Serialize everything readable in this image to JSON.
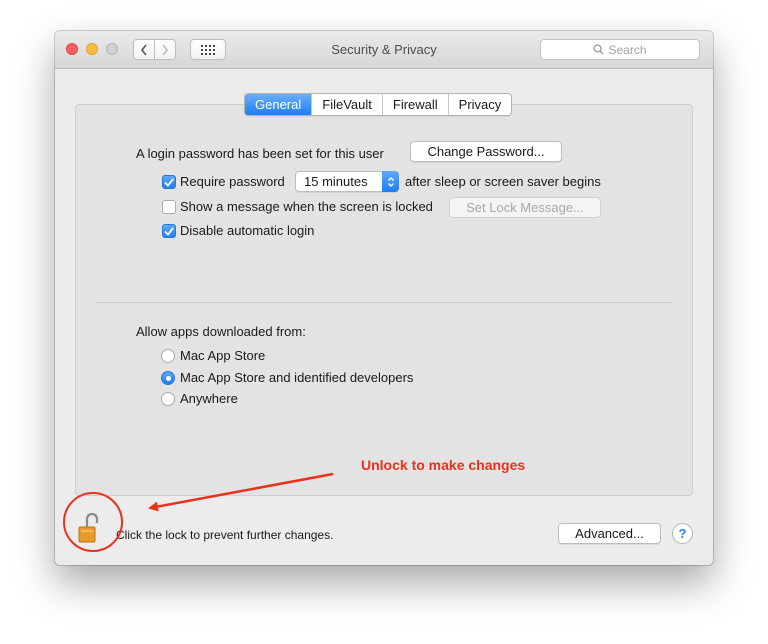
{
  "window": {
    "title": "Security & Privacy"
  },
  "toolbar": {
    "search_placeholder": "Search"
  },
  "tabs": [
    {
      "label": "General",
      "active": true
    },
    {
      "label": "FileVault",
      "active": false
    },
    {
      "label": "Firewall",
      "active": false
    },
    {
      "label": "Privacy",
      "active": false
    }
  ],
  "general": {
    "login_text": "A login password has been set for this user",
    "change_password_label": "Change Password...",
    "require_password": {
      "label": "Require password",
      "checked": true,
      "interval": "15 minutes",
      "suffix": "after sleep or screen saver begins"
    },
    "show_message": {
      "label": "Show a message when the screen is locked",
      "checked": false,
      "button_label": "Set Lock Message..."
    },
    "disable_autologin": {
      "label": "Disable automatic login",
      "checked": true
    },
    "allow_apps_label": "Allow apps downloaded from:",
    "allow_options": [
      {
        "label": "Mac App Store",
        "selected": false
      },
      {
        "label": "Mac App Store and identified developers",
        "selected": true
      },
      {
        "label": "Anywhere",
        "selected": false
      }
    ]
  },
  "footer": {
    "lock_text": "Click the lock to prevent further changes.",
    "advanced_label": "Advanced...",
    "help_label": "?"
  },
  "annotation": {
    "text": "Unlock to make changes",
    "color": "#e8321b"
  },
  "colors": {
    "accent": "#1d7ef2",
    "annotation": "#e8321b",
    "lock_body": "#e59a2a"
  },
  "icons": [
    "back-chevron-icon",
    "forward-chevron-icon",
    "grid-icon",
    "search-icon",
    "checkmark-icon",
    "popup-arrows-icon",
    "lock-open-icon",
    "help-icon"
  ]
}
